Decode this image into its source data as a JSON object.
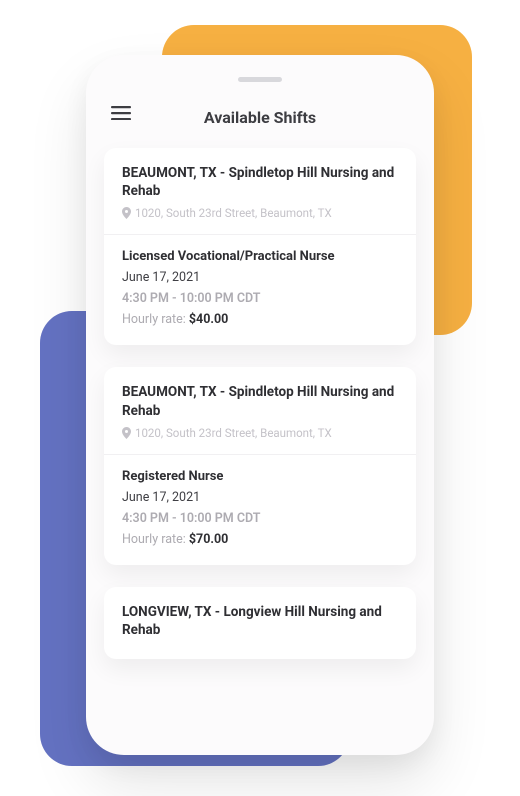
{
  "decor": {
    "orange": "#f6b042",
    "blue": "#6472c2"
  },
  "header": {
    "title": "Available Shifts"
  },
  "shifts": [
    {
      "facility": "BEAUMONT, TX - Spindletop Hill Nursing and Rehab",
      "address": "1020, South 23rd Street, Beaumont, TX",
      "role": "Licensed Vocational/Practical Nurse",
      "date": "June 17, 2021",
      "time": "4:30 PM - 10:00 PM CDT",
      "rate_label": "Hourly rate: ",
      "rate": "$40.00"
    },
    {
      "facility": "BEAUMONT, TX - Spindletop Hill Nursing and Rehab",
      "address": "1020, South 23rd Street, Beaumont, TX",
      "role": "Registered Nurse",
      "date": "June 17, 2021",
      "time": "4:30 PM - 10:00 PM CDT",
      "rate_label": "Hourly rate: ",
      "rate": "$70.00"
    },
    {
      "facility": "LONGVIEW, TX - Longview Hill Nursing and Rehab"
    }
  ]
}
